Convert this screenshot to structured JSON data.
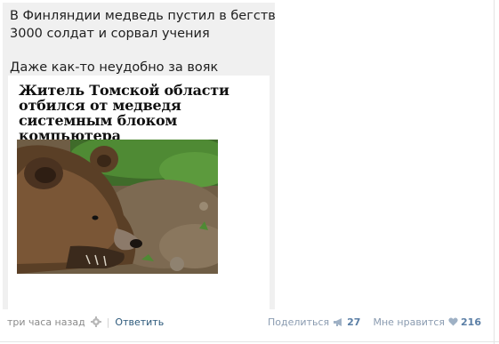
{
  "post": {
    "text_line1": "В Финляндии медведь пустил в бегство",
    "text_line2": "3000 солдат и сорвал учения",
    "comment": "Даже как-то неудобно за вояк",
    "news": {
      "headline": "Житель Томской области отбился от медведя системным блоком компьютера"
    }
  },
  "footer": {
    "timestamp": "три часа назад",
    "divider": "|",
    "reply_label": "Ответить",
    "share_label": "Поделиться",
    "share_count": "27",
    "like_label": "Мне нравится",
    "like_count": "216"
  },
  "icons": {
    "settings": "gear-icon",
    "share": "megaphone-icon",
    "like": "heart-icon"
  },
  "colors": {
    "link": "#2b587a",
    "count": "#5b7fa6",
    "muted": "#8a8a8a",
    "card_bg": "#f0f0f0"
  }
}
